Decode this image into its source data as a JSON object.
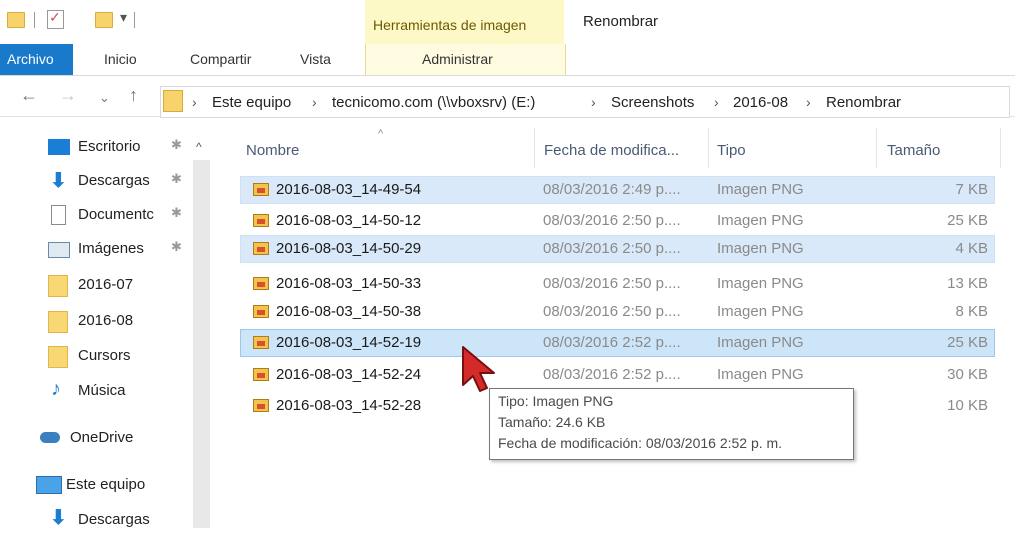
{
  "window": {
    "title": "Renombrar",
    "contextual_group": "Herramientas de imagen"
  },
  "ribbon": {
    "tabs": [
      "Archivo",
      "Inicio",
      "Compartir",
      "Vista"
    ],
    "contextual_tab": "Administrar",
    "accent": "#1979ca"
  },
  "address": {
    "crumbs": [
      "Este equipo",
      "tecnicomo.com (\\\\vboxsrv) (E:)",
      "Screenshots",
      "2016-08",
      "Renombrar"
    ]
  },
  "sidebar": {
    "items": [
      {
        "label": "Escritorio",
        "icon": "desktop-icon",
        "pinned": true
      },
      {
        "label": "Descargas",
        "icon": "download-arrow-icon",
        "pinned": true
      },
      {
        "label": "Documentc",
        "icon": "document-icon",
        "pinned": true
      },
      {
        "label": "Imágenes",
        "icon": "pictures-icon",
        "pinned": true
      },
      {
        "label": "2016-07",
        "icon": "folder-icon"
      },
      {
        "label": "2016-08",
        "icon": "folder-icon"
      },
      {
        "label": "Cursors",
        "icon": "folder-icon"
      },
      {
        "label": "Música",
        "icon": "music-note-icon"
      },
      {
        "label": "OneDrive",
        "icon": "onedrive-cloud-icon"
      },
      {
        "label": "Este equipo",
        "icon": "computer-icon"
      },
      {
        "label": "Descargas",
        "icon": "download-arrow-icon"
      }
    ]
  },
  "columns": [
    "Nombre",
    "Fecha de modifica...",
    "Tipo",
    "Tamaño"
  ],
  "files": [
    {
      "name": "2016-08-03_14-49-54",
      "date": "08/03/2016 2:49 p....",
      "type": "Imagen PNG",
      "size": "7 KB"
    },
    {
      "name": "2016-08-03_14-50-12",
      "date": "08/03/2016 2:50 p....",
      "type": "Imagen PNG",
      "size": "25 KB"
    },
    {
      "name": "2016-08-03_14-50-29",
      "date": "08/03/2016 2:50 p....",
      "type": "Imagen PNG",
      "size": "4 KB"
    },
    {
      "name": "2016-08-03_14-50-33",
      "date": "08/03/2016 2:50 p....",
      "type": "Imagen PNG",
      "size": "13 KB"
    },
    {
      "name": "2016-08-03_14-50-38",
      "date": "08/03/2016 2:50 p....",
      "type": "Imagen PNG",
      "size": "8 KB"
    },
    {
      "name": "2016-08-03_14-52-19",
      "date": "08/03/2016 2:52 p....",
      "type": "Imagen PNG",
      "size": "25 KB"
    },
    {
      "name": "2016-08-03_14-52-24",
      "date": "08/03/2016 2:52 p....",
      "type": "Imagen PNG",
      "size": "30 KB"
    },
    {
      "name": "2016-08-03_14-52-28",
      "date": "",
      "type": "",
      "size": "10 KB"
    }
  ],
  "tooltip": {
    "type_line": "Tipo: Imagen PNG",
    "size_line": "Tamaño: 24.6 KB",
    "date_line": "Fecha de modificación: 08/03/2016 2:52 p. m."
  },
  "colors": {
    "selection": "#d9e9f9",
    "hover": "#cde5f9",
    "cursor": "#d42a2a"
  }
}
